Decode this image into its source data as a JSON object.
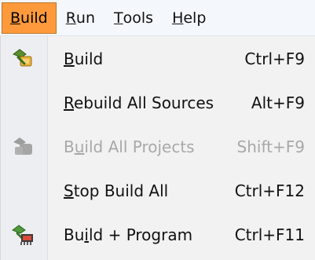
{
  "menubar": {
    "items": [
      {
        "pre": "",
        "key": "B",
        "post": "uild"
      },
      {
        "pre": "",
        "key": "R",
        "post": "un"
      },
      {
        "pre": "",
        "key": "T",
        "post": "ools"
      },
      {
        "pre": "",
        "key": "H",
        "post": "elp"
      }
    ]
  },
  "menu": {
    "items": [
      {
        "pre": "",
        "key": "B",
        "post": "uild",
        "shortcut": "Ctrl+F9",
        "icon": "build-icon"
      },
      {
        "pre": "",
        "key": "R",
        "post": "ebuild All Sources",
        "shortcut": "Alt+F9",
        "icon": ""
      },
      {
        "pre": "B",
        "key": "u",
        "post": "ild All Projects",
        "shortcut": "Shift+F9",
        "icon": "build-all-projects-icon"
      },
      {
        "pre": "",
        "key": "S",
        "post": "top Build All",
        "shortcut": "Ctrl+F12",
        "icon": ""
      },
      {
        "pre": "Bu",
        "key": "i",
        "post": "ld + Program",
        "shortcut": "Ctrl+F11",
        "icon": "build-program-icon"
      }
    ]
  },
  "colors": {
    "active_menu_bg": "#ff9a3c",
    "disabled_text": "#a8a8a8"
  }
}
